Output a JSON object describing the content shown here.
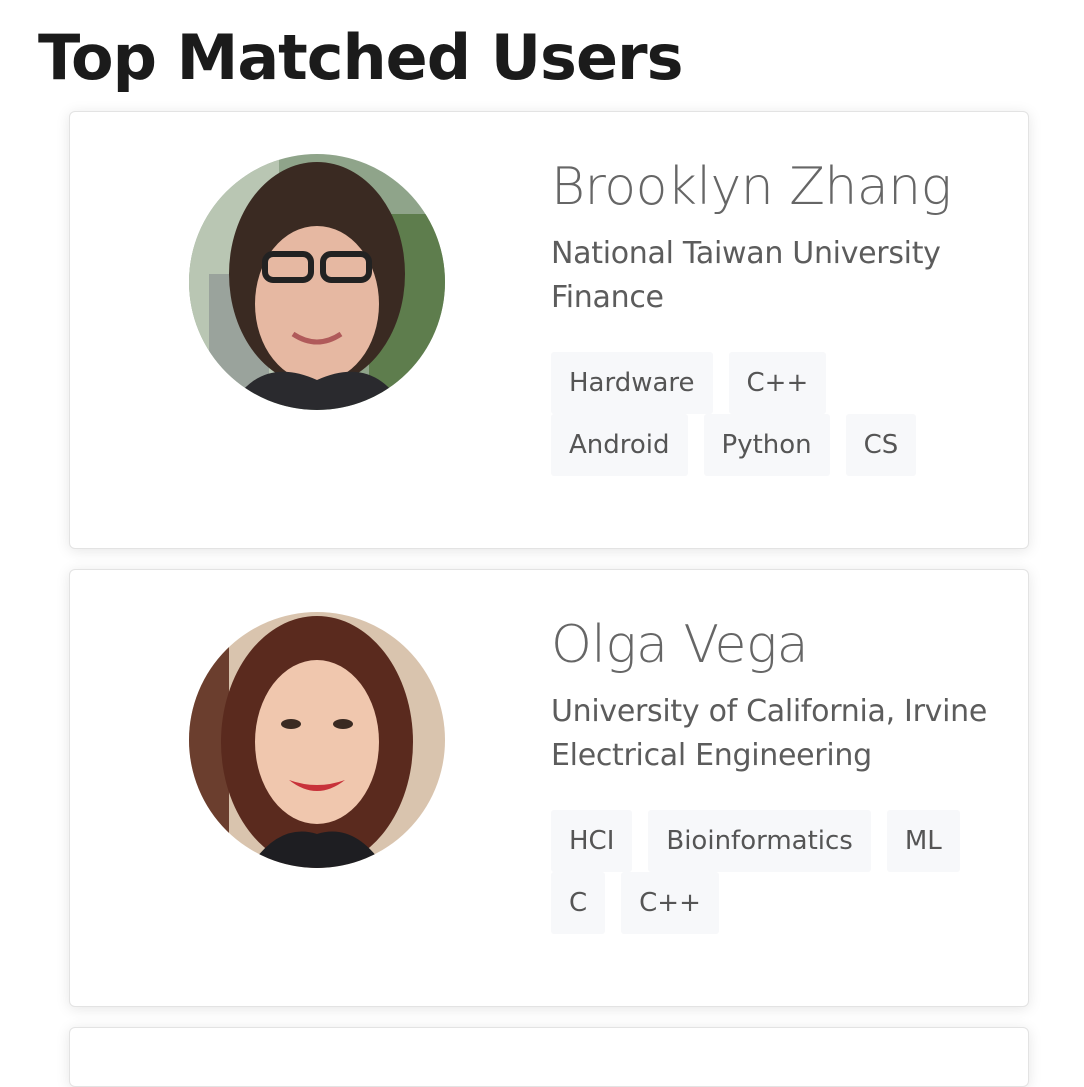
{
  "page": {
    "title": "Top Matched Users"
  },
  "users": [
    {
      "name": "Brooklyn Zhang",
      "school": "National Taiwan University",
      "major": "Finance",
      "tags": [
        "Hardware",
        "C++",
        "Android",
        "Python",
        "CS"
      ]
    },
    {
      "name": "Olga Vega",
      "school": "University of California, Irvine",
      "major": "Electrical Engineering",
      "tags": [
        "HCI",
        "Bioinformatics",
        "ML",
        "C",
        "C++"
      ]
    }
  ],
  "colors": {
    "title": "#1b1b1b",
    "name": "#666666",
    "text": "#5c5c5c",
    "tag_bg": "#f7f8fa",
    "card_border": "#e3e3e3"
  }
}
